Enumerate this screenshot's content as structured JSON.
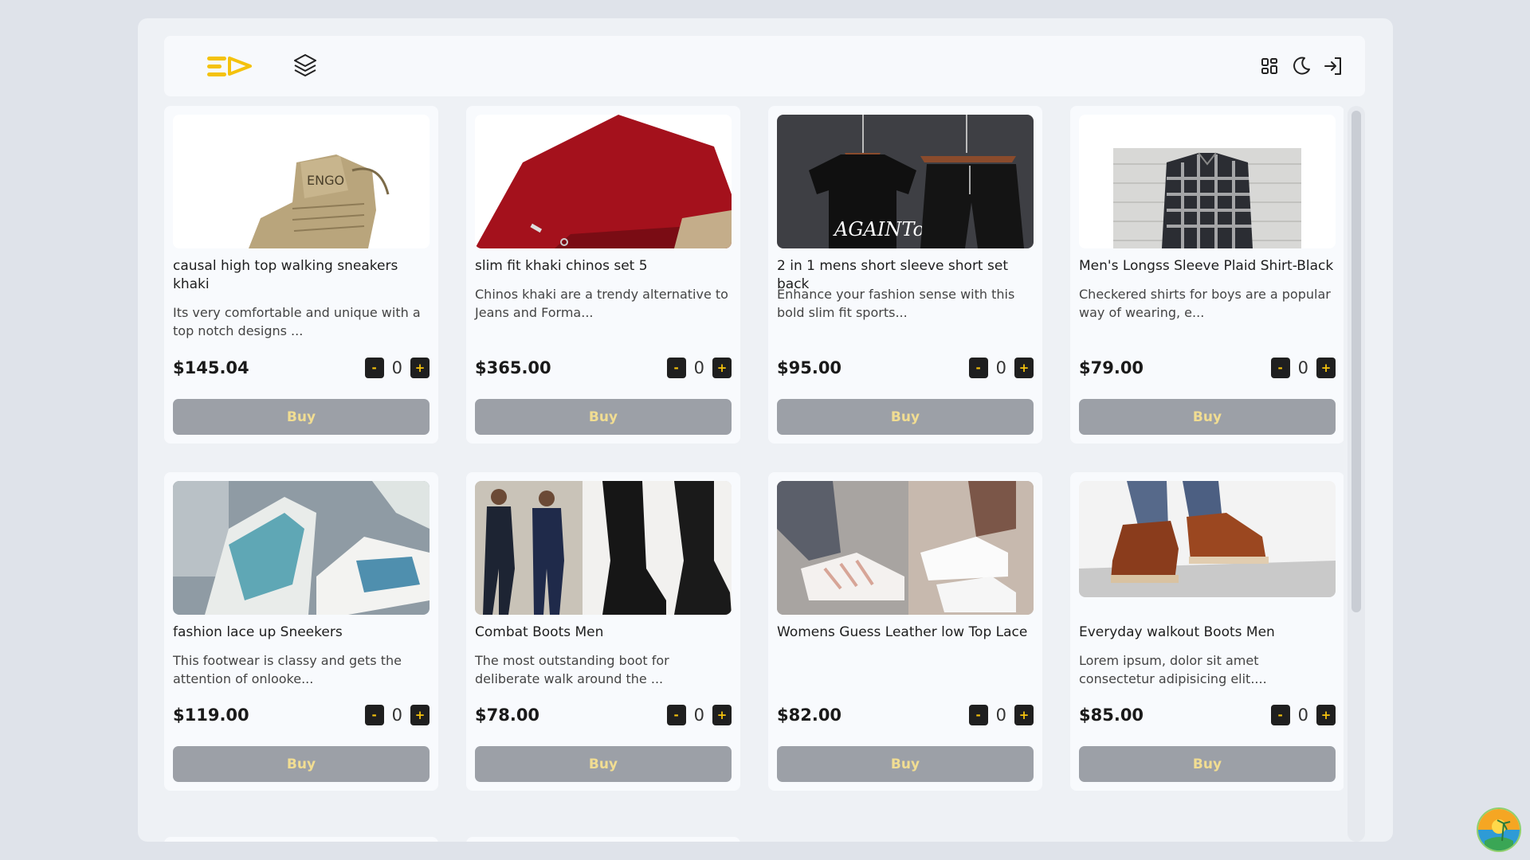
{
  "colors": {
    "accent": "#f4c20d",
    "buy_button": "#9ca0a7",
    "buy_text": "#f1dd92"
  },
  "header": {
    "logo_icon": "brand-logo-icon",
    "layers_icon": "layers-icon",
    "actions": [
      "dashboard-icon",
      "moon-icon",
      "login-icon"
    ]
  },
  "products": [
    {
      "title": "causal high top walking sneakers khaki",
      "desc": "Its very comfortable and unique with a top notch designs ...",
      "price": "$145.04",
      "qty": "0",
      "minus": "-",
      "plus": "+",
      "buy": "Buy"
    },
    {
      "title": "slim fit khaki chinos set 5",
      "desc": "Chinos khaki are a trendy alternative to Jeans and Forma...",
      "price": "$365.00",
      "qty": "0",
      "minus": "-",
      "plus": "+",
      "buy": "Buy"
    },
    {
      "title": "2 in 1 mens short sleeve short set back",
      "desc": "Enhance your fashion sense with this bold slim fit sports...",
      "price": "$95.00",
      "qty": "0",
      "minus": "-",
      "plus": "+",
      "buy": "Buy"
    },
    {
      "title": "Men's Longss Sleeve Plaid Shirt-Black",
      "desc": "Checkered shirts for boys are a popular way of wearing, e...",
      "price": "$79.00",
      "qty": "0",
      "minus": "-",
      "plus": "+",
      "buy": "Buy"
    },
    {
      "title": "fashion lace up Sneekers",
      "desc": "This footwear is classy and gets the attention of onlooke...",
      "price": "$119.00",
      "qty": "0",
      "minus": "-",
      "plus": "+",
      "buy": "Buy"
    },
    {
      "title": "Combat Boots Men",
      "desc": "The most outstanding boot for deliberate walk around the ...",
      "price": "$78.00",
      "qty": "0",
      "minus": "-",
      "plus": "+",
      "buy": "Buy"
    },
    {
      "title": "Womens Guess Leather low Top Lace",
      "desc": "",
      "price": "$82.00",
      "qty": "0",
      "minus": "-",
      "plus": "+",
      "buy": "Buy"
    },
    {
      "title": "Everyday walkout Boots Men",
      "desc": "Lorem ipsum, dolor sit amet consectetur adipisicing elit....",
      "price": "$85.00",
      "qty": "0",
      "minus": "-",
      "plus": "+",
      "buy": "Buy"
    }
  ],
  "image_subjects": [
    "khaki-boot-image",
    "red-chinos-image",
    "tshirt-shorts-set-image",
    "plaid-shirt-image",
    "blue-sneakers-image",
    "combat-boots-image",
    "white-sneakers-image",
    "brown-boots-image"
  ],
  "avatar_icon": "user-avatar-icon"
}
